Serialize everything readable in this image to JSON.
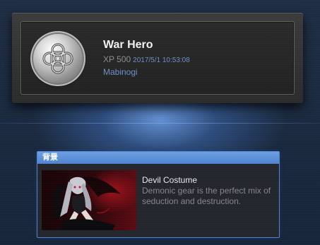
{
  "achievement": {
    "title": "War Hero",
    "xp": "XP 500",
    "date": "2017/5/1 10:53:08",
    "game": "Mabinogi",
    "icon": "celtic-knot-medal-icon"
  },
  "background_panel": {
    "header": "背景",
    "item_name": "Devil Costume",
    "item_description": "Demonic gear is the perfect mix of seduction and destruction.",
    "image": "devil-costume-character-art"
  },
  "colors": {
    "accent_blue": "#4f84d0",
    "link_blue": "#6e8fc4",
    "title_white": "#f1f1f1",
    "muted_gray": "#868686"
  }
}
